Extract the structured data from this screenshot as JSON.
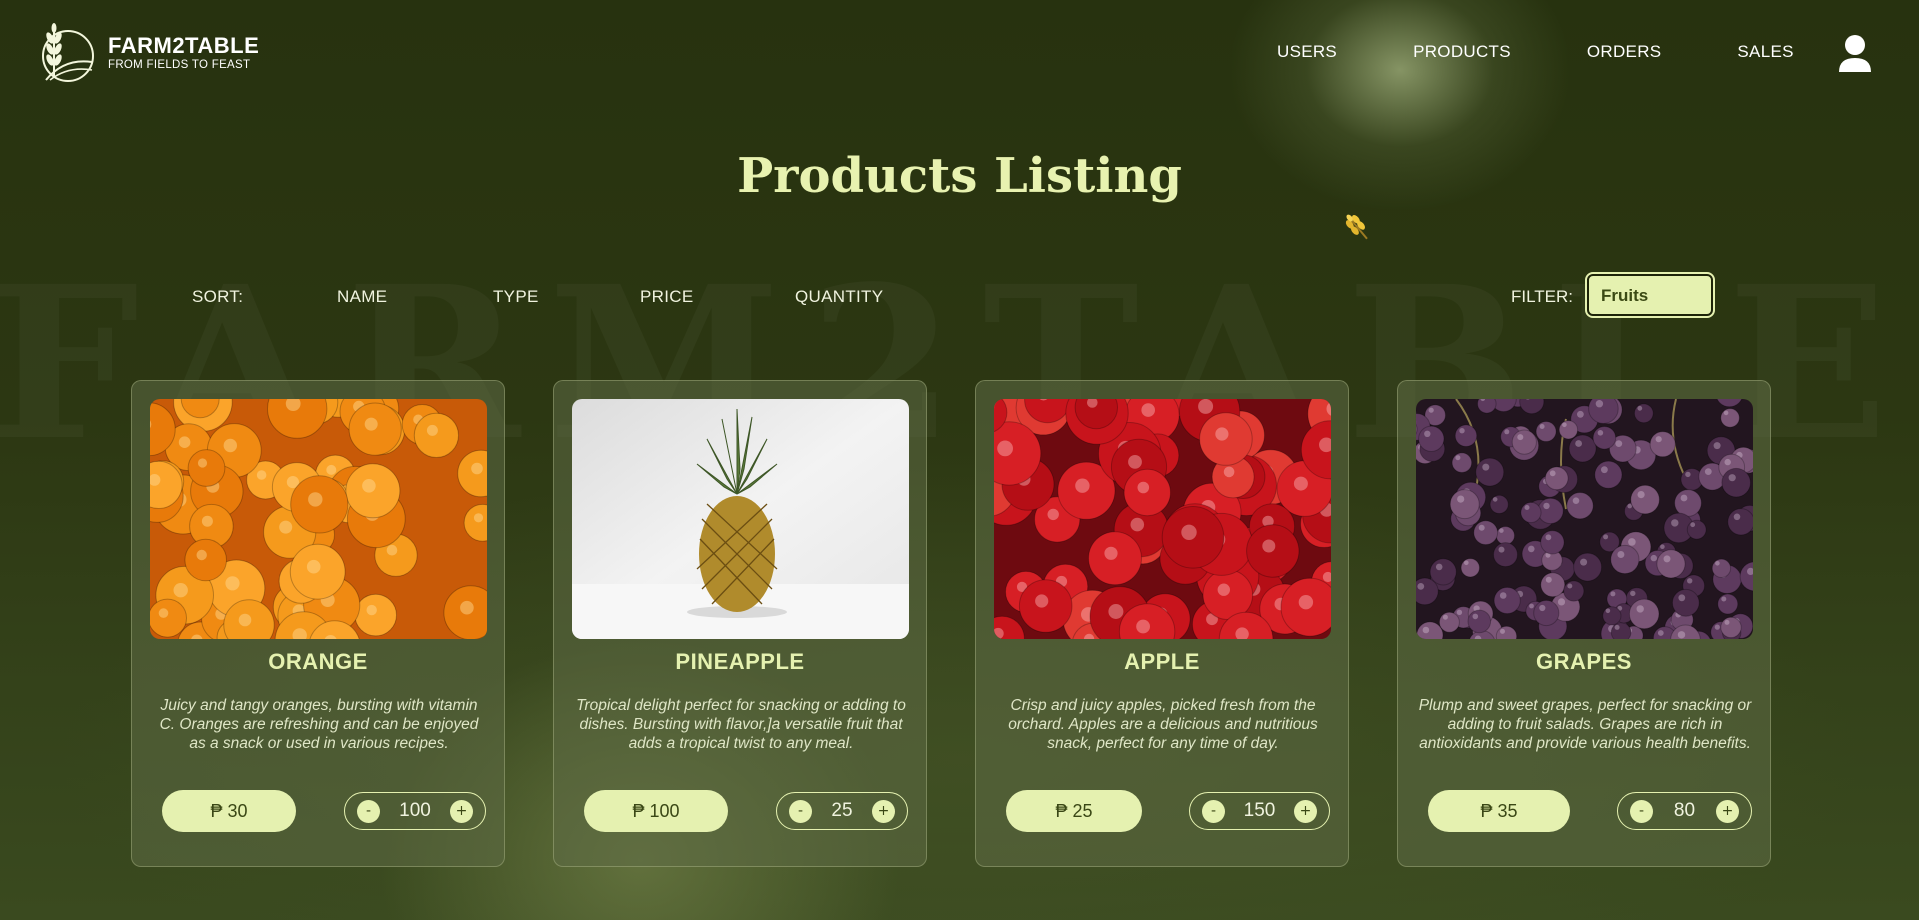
{
  "brand": {
    "name": "FARM2TABLE",
    "tagline": "FROM FIELDS TO FEAST",
    "watermark": "FARM2TABLE"
  },
  "nav": {
    "items": [
      {
        "label": "USERS"
      },
      {
        "label": "PRODUCTS"
      },
      {
        "label": "ORDERS"
      },
      {
        "label": "SALES"
      }
    ],
    "user_icon": "user-icon"
  },
  "page": {
    "title": "Products Listing"
  },
  "sort": {
    "label": "SORT:",
    "options": [
      "NAME",
      "TYPE",
      "PRICE",
      "QUANTITY"
    ]
  },
  "filter": {
    "label": "FILTER:",
    "selected": "Fruits"
  },
  "colors": {
    "accent": "#e5f1b0",
    "background": "#2c3712",
    "card": "#5f6c46"
  },
  "products": [
    {
      "name": "ORANGE",
      "description": "Juicy and tangy oranges, bursting with vitamin C. Oranges are refreshing and can be enjoyed as a snack or used in various recipes.",
      "price": "₱ 30",
      "quantity": "100",
      "image": "oranges-photo"
    },
    {
      "name": "PINEAPPLE",
      "description": "Tropical delight perfect for snacking or adding to dishes. Bursting with flavor,]a versatile fruit that adds a tropical twist to any meal.",
      "price": "₱ 100",
      "quantity": "25",
      "image": "pineapple-photo"
    },
    {
      "name": "APPLE",
      "description": "Crisp and juicy apples, picked fresh from the orchard. Apples are a delicious and nutritious snack, perfect for any time of day.",
      "price": "₱ 25",
      "quantity": "150",
      "image": "apples-photo"
    },
    {
      "name": "GRAPES",
      "description": "Plump and sweet grapes, perfect for snacking or adding to fruit salads. Grapes are rich in antioxidants and provide various health benefits.",
      "price": "₱ 35",
      "quantity": "80",
      "image": "grapes-photo"
    }
  ],
  "stepper": {
    "minus": "-",
    "plus": "+"
  }
}
